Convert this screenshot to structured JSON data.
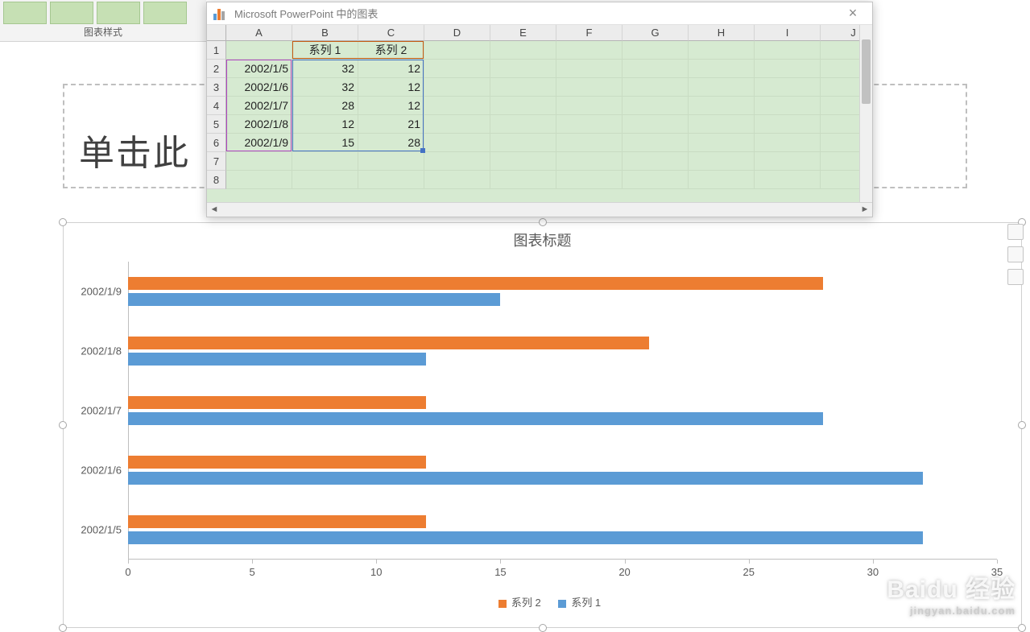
{
  "ribbon": {
    "group_label": "图表样式"
  },
  "slide": {
    "title_placeholder": "单击此"
  },
  "data_window": {
    "title": "Microsoft PowerPoint 中的图表",
    "columns": [
      "A",
      "B",
      "C",
      "D",
      "E",
      "F",
      "G",
      "H",
      "I",
      "J"
    ],
    "row_numbers": [
      "1",
      "2",
      "3",
      "4",
      "5",
      "6",
      "7",
      "8"
    ],
    "header": {
      "B": "系列 1",
      "C": "系列 2"
    },
    "rows": [
      {
        "A": "2002/1/5",
        "B": "32",
        "C": "12"
      },
      {
        "A": "2002/1/6",
        "B": "32",
        "C": "12"
      },
      {
        "A": "2002/1/7",
        "B": "28",
        "C": "12"
      },
      {
        "A": "2002/1/8",
        "B": "12",
        "C": "21"
      },
      {
        "A": "2002/1/9",
        "B": "15",
        "C": "28"
      }
    ]
  },
  "chart_data": {
    "type": "bar",
    "title": "图表标题",
    "categories": [
      "2002/1/5",
      "2002/1/6",
      "2002/1/7",
      "2002/1/8",
      "2002/1/9"
    ],
    "series": [
      {
        "name": "系列 1",
        "values": [
          32,
          32,
          28,
          12,
          15
        ],
        "color": "#5b9bd5"
      },
      {
        "name": "系列 2",
        "values": [
          12,
          12,
          12,
          21,
          28
        ],
        "color": "#ed7d31"
      }
    ],
    "x_ticks": [
      0,
      5,
      10,
      15,
      20,
      25,
      30,
      35
    ],
    "xlim": [
      0,
      35
    ],
    "xlabel": "",
    "ylabel": ""
  },
  "legend": {
    "s1": "系列 1",
    "s2": "系列 2"
  },
  "watermark": {
    "brand": "Baidu 经验",
    "url": "jingyan.baidu.com"
  }
}
